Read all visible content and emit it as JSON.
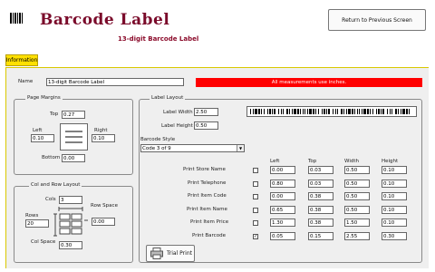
{
  "header": {
    "title": "Barcode Label",
    "subtitle": "13-digit Barcode Label",
    "return_button": "Return to Previous Screen"
  },
  "tabs": [
    {
      "label": "Information",
      "active": true
    }
  ],
  "form": {
    "name_label": "Name",
    "name_value": "13-digit Barcode Label",
    "units_notice": "All measurements use inches."
  },
  "page_margins": {
    "title": "Page Margins",
    "top_label": "Top",
    "top_value": "0.27",
    "left_label": "Left",
    "left_value": "0.10",
    "right_label": "Right",
    "right_value": "0.10",
    "bottom_label": "Bottom",
    "bottom_value": "0.00"
  },
  "col_row_layout": {
    "title": "Col and Row Layout",
    "cols_label": "Cols",
    "cols_value": "3",
    "rows_label": "Rows",
    "rows_value": "20",
    "row_space_label": "Row Space",
    "row_space_value": "0.00",
    "col_space_label": "Col Space",
    "col_space_value": "0.30"
  },
  "label_layout": {
    "title": "Label Layout",
    "width_label": "Label Width",
    "width_value": "2.50",
    "height_label": "Label Height",
    "height_value": "0.50",
    "barcode_style_label": "Barcode Style",
    "barcode_style_value": "Code 3 of 9",
    "columns": [
      "Left",
      "Top",
      "Width",
      "Height"
    ],
    "rows": [
      {
        "label": "Print Store Name",
        "checked": false,
        "values": [
          "0.00",
          "0.03",
          "0.50",
          "0.10"
        ]
      },
      {
        "label": "Print Telephone",
        "checked": false,
        "values": [
          "0.80",
          "0.03",
          "0.50",
          "0.10"
        ]
      },
      {
        "label": "Print Item Code",
        "checked": false,
        "values": [
          "0.00",
          "0.38",
          "0.50",
          "0.10"
        ]
      },
      {
        "label": "Print Item Name",
        "checked": false,
        "values": [
          "0.65",
          "0.38",
          "0.50",
          "0.10"
        ]
      },
      {
        "label": "Print Item Price",
        "checked": false,
        "values": [
          "1.30",
          "0.38",
          "1.50",
          "0.10"
        ]
      },
      {
        "label": "Print Barcode",
        "checked": true,
        "values": [
          "0.05",
          "0.15",
          "2.55",
          "0.30"
        ]
      }
    ],
    "trial_print_label": "Trial Print"
  },
  "colors": {
    "accent_yellow": "#ffe000",
    "title_red": "#7a0a2a",
    "banner_red": "#ff0000"
  },
  "icons": {
    "app": "barcode-icon",
    "trial_print": "printer-icon",
    "dropdown": "chevron-down-icon"
  }
}
